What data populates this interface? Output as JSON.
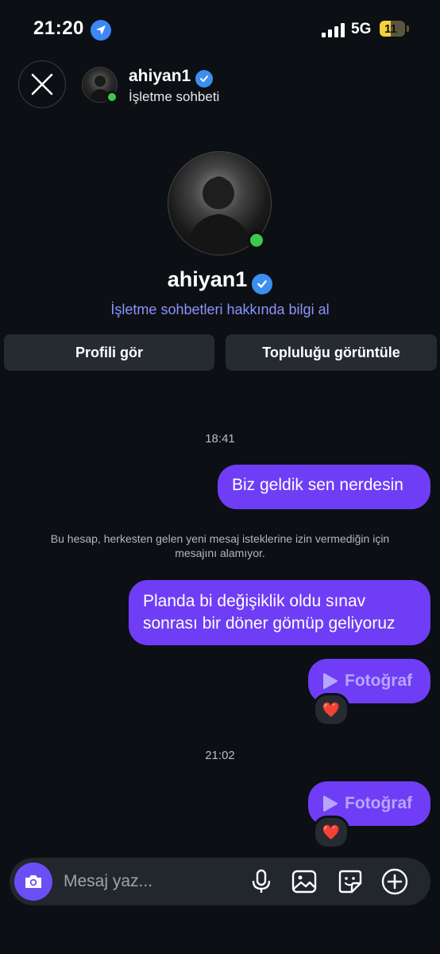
{
  "status_bar": {
    "time": "21:20",
    "network": "5G",
    "battery": "11"
  },
  "header": {
    "username": "ahiyan1",
    "subtitle": "İşletme sohbeti"
  },
  "profile": {
    "username": "ahiyan1",
    "info_link": "İşletme sohbetleri hakkında bilgi al",
    "view_profile_button": "Profili gör",
    "view_community_button": "Topluluğu görüntüle"
  },
  "messages": {
    "timestamp_1": "18:41",
    "msg_1": "Biz geldik sen nerdesin",
    "notice": "Bu hesap, herkesten gelen yeni mesaj isteklerine izin vermediğin için mesajını alamıyor.",
    "msg_2_line1": "Planda bi değişiklik oldu sınav",
    "msg_2_line2": "sonrası bir döner gömüp geliyoruz",
    "photo_1": "Fotoğraf",
    "reaction_1": "❤️",
    "timestamp_2": "21:02",
    "photo_2": "Fotoğraf",
    "reaction_2": "❤️"
  },
  "composer": {
    "placeholder": "Mesaj yaz..."
  },
  "colors": {
    "background": "#0c0f14",
    "bubble": "#6f3df5",
    "link": "#8c93ff",
    "online": "#3ec84e",
    "verified": "#3b8ff0"
  }
}
